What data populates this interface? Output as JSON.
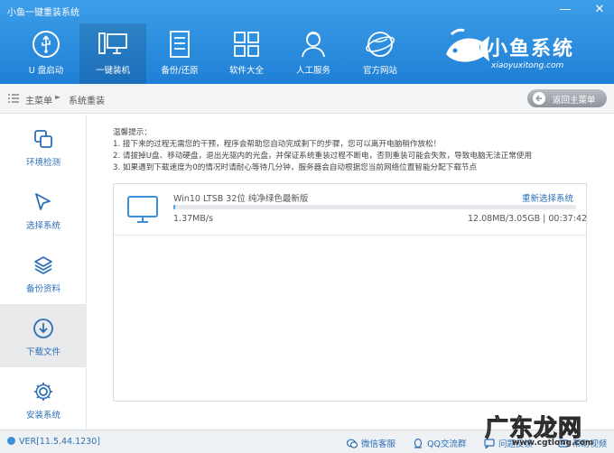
{
  "window": {
    "title": "小鱼一键重装系统",
    "min_label": "—",
    "close_label": "✕"
  },
  "nav": [
    {
      "label": "U 盘启动",
      "icon": "usb-icon",
      "active": false
    },
    {
      "label": "一键装机",
      "icon": "computer-icon",
      "active": true
    },
    {
      "label": "备份/还原",
      "icon": "backup-icon",
      "active": false
    },
    {
      "label": "软件大全",
      "icon": "apps-grid-icon",
      "active": false
    },
    {
      "label": "人工服务",
      "icon": "support-person-icon",
      "active": false
    },
    {
      "label": "官方网站",
      "icon": "globe-icon",
      "active": false
    }
  ],
  "brand": {
    "name": "小鱼系统",
    "domain": "xiaoyuxitong.com"
  },
  "breadcrumb": {
    "home": "主菜单",
    "separator": "►",
    "current": "系统重装",
    "back_button": "返回主菜单"
  },
  "sidebar": [
    {
      "label": "环境检测",
      "icon": "environment-check-icon",
      "active": false
    },
    {
      "label": "选择系统",
      "icon": "cursor-select-icon",
      "active": false
    },
    {
      "label": "备份资料",
      "icon": "layers-backup-icon",
      "active": false
    },
    {
      "label": "下载文件",
      "icon": "download-icon",
      "active": true
    },
    {
      "label": "安装系统",
      "icon": "install-gear-icon",
      "active": false
    }
  ],
  "tips": {
    "heading": "温馨提示：",
    "lines": [
      "1. 接下来的过程无需您的干预，程序会帮助您自动完成剩下的步骤，您可以离开电脑稍作放松！",
      "2. 请拔掉U盘、移动硬盘，退出光驱内的光盘，并保证系统重装过程不断电，否则重装可能会失败，导致电脑无法正常使用",
      "3. 如果遇到下载速度为0的情况时请耐心等待几分钟，服务器会自动根据您当前网络位置智能分配下载节点"
    ]
  },
  "download": {
    "system_name": "Win10 LTSB 32位 纯净绿色最新版",
    "reselect_label": "重新选择系统",
    "speed": "1.37MB/s",
    "size_time": "12.08MB/3.05GB | 00:37:42",
    "progress_fraction": 0.004
  },
  "footer": {
    "version": "VER[11.5.44.1230]",
    "links": [
      "微信客服",
      "QQ交流群",
      "问题反馈",
      "帮助视频"
    ]
  },
  "watermark": {
    "text": "广东龙网",
    "url": "www.cgtlong.com"
  },
  "colors": {
    "header_blue": "#2a8be0",
    "link_blue": "#2b6fb6",
    "progress_blue": "#4aa3ea"
  }
}
